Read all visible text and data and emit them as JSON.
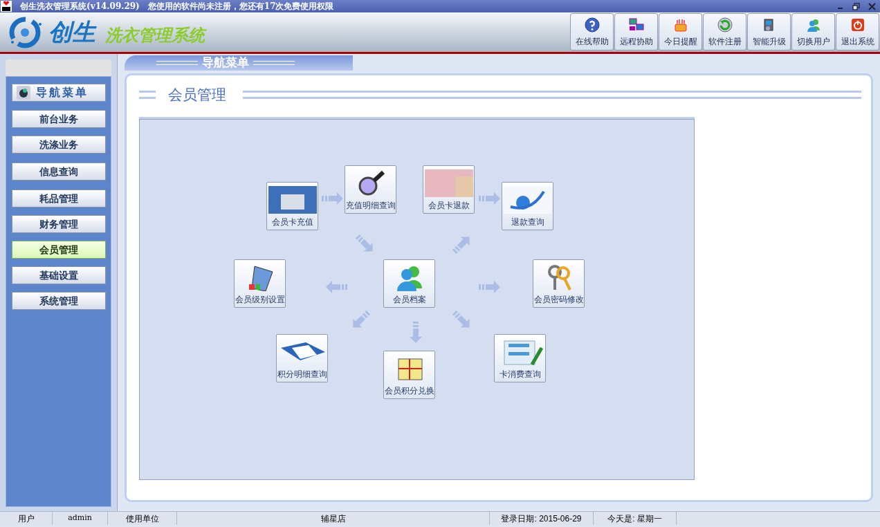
{
  "window": {
    "title": "创生洗衣管理系统(v14.09.29)　您使用的软件尚未注册，您还有17次免费使用权限"
  },
  "logo": {
    "brand": "创生",
    "product": "洗衣管理系统"
  },
  "toolbar": [
    {
      "label": "在线帮助"
    },
    {
      "label": "远程协助"
    },
    {
      "label": "今日提醒"
    },
    {
      "label": "软件注册"
    },
    {
      "label": "智能升级"
    },
    {
      "label": "切换用户"
    },
    {
      "label": "退出系统"
    }
  ],
  "nav_tab": {
    "label": "导航菜单"
  },
  "sidebar": {
    "header": "导航菜单",
    "items": [
      {
        "label": "前台业务",
        "selected": false
      },
      {
        "label": "洗涤业务",
        "selected": false
      },
      {
        "label": "信息查询",
        "selected": false
      },
      {
        "label": "耗品管理",
        "selected": false
      },
      {
        "label": "财务管理",
        "selected": false
      },
      {
        "label": "会员管理",
        "selected": true
      },
      {
        "label": "基础设置",
        "selected": false
      },
      {
        "label": "系统管理",
        "selected": false
      }
    ]
  },
  "page": {
    "title": "会员管理",
    "tiles": [
      {
        "label": "会员卡充值"
      },
      {
        "label": "充值明细查询"
      },
      {
        "label": "会员卡退款"
      },
      {
        "label": "退款查询"
      },
      {
        "label": "会员级别设置"
      },
      {
        "label": "会员档案"
      },
      {
        "label": "会员密码修改"
      },
      {
        "label": "积分明细查询"
      },
      {
        "label": "会员积分兑换"
      },
      {
        "label": "卡消费查询"
      }
    ]
  },
  "status_bar": [
    "用户",
    "admin",
    "使用单位",
    "辅星店",
    "登录日期: 2015-06-29",
    "今天是: 星期一"
  ]
}
